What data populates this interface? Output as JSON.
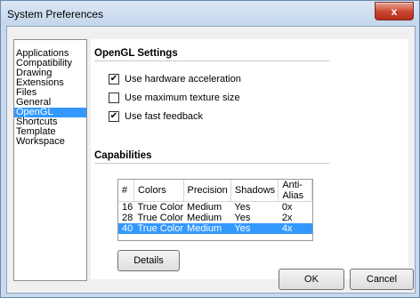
{
  "window": {
    "title": "System Preferences",
    "close_label": "x"
  },
  "categories": [
    "Applications",
    "Compatibility",
    "Drawing",
    "Extensions",
    "Files",
    "General",
    "OpenGL",
    "Shortcuts",
    "Template",
    "Workspace"
  ],
  "selected_category": "OpenGL",
  "opengl": {
    "title": "OpenGL Settings",
    "options": [
      {
        "label": "Use hardware acceleration",
        "checked": true
      },
      {
        "label": "Use maximum texture size",
        "checked": false
      },
      {
        "label": "Use fast feedback",
        "checked": true
      }
    ]
  },
  "capabilities": {
    "title": "Capabilities",
    "columns": [
      "#",
      "Colors",
      "Precision",
      "Shadows",
      "Anti-Alias"
    ],
    "rows": [
      [
        "16",
        "True Color",
        "Medium",
        "Yes",
        "0x"
      ],
      [
        "28",
        "True Color",
        "Medium",
        "Yes",
        "2x"
      ],
      [
        "40",
        "True Color",
        "Medium",
        "Yes",
        "4x"
      ]
    ],
    "selected_row": 2
  },
  "buttons": {
    "details": "Details",
    "ok": "OK",
    "cancel": "Cancel"
  }
}
